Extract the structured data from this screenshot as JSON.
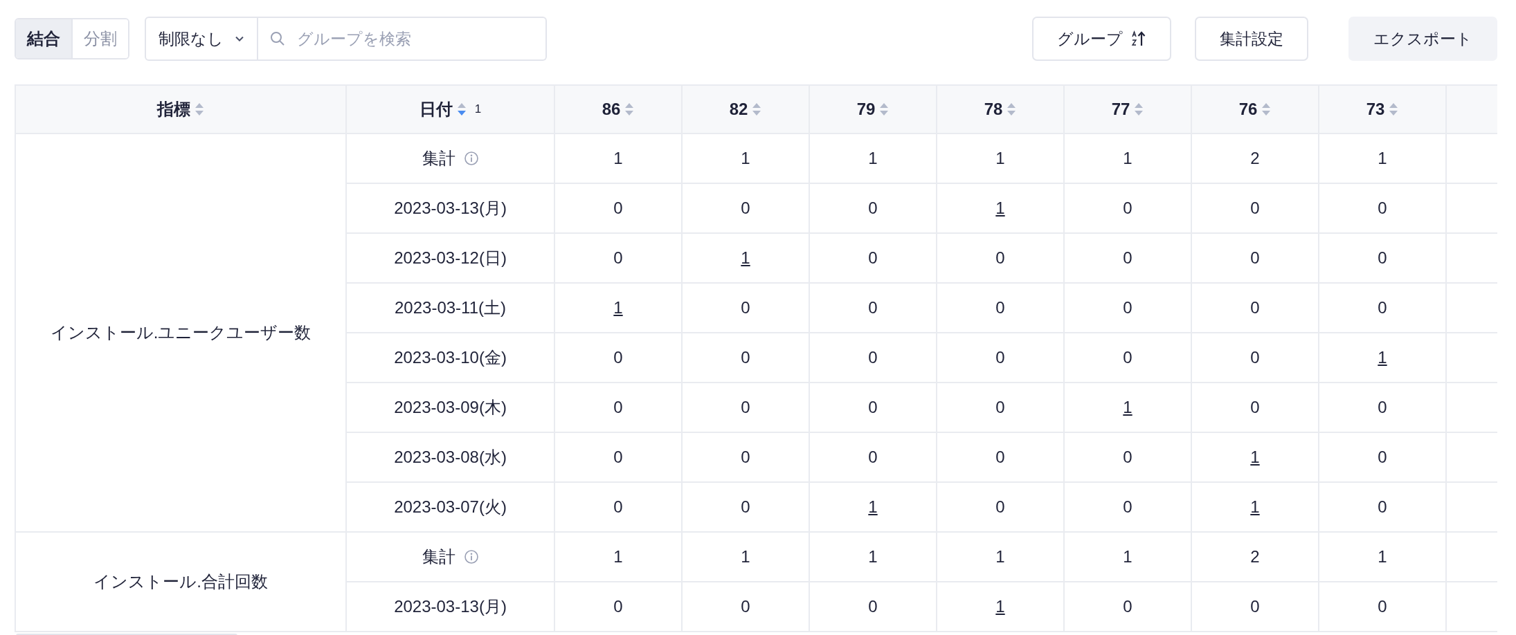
{
  "toolbar": {
    "view_toggle": [
      {
        "label": "結合",
        "selected": true
      },
      {
        "label": "分割",
        "selected": false
      }
    ],
    "limit_select": {
      "value": "制限なし"
    },
    "search": {
      "placeholder": "グループを検索"
    },
    "buttons": [
      {
        "label": "グループ",
        "kind": "sort"
      },
      {
        "label": "集計設定",
        "kind": "outline"
      },
      {
        "label": "エクスポート",
        "kind": "filled"
      }
    ]
  },
  "table": {
    "columns": [
      {
        "label": "指標",
        "sorted": false
      },
      {
        "label": "日付",
        "sorted": true,
        "priority": "1"
      },
      {
        "label": "86",
        "sorted": false
      },
      {
        "label": "82",
        "sorted": false
      },
      {
        "label": "79",
        "sorted": false
      },
      {
        "label": "78",
        "sorted": false
      },
      {
        "label": "77",
        "sorted": false
      },
      {
        "label": "76",
        "sorted": false
      },
      {
        "label": "73",
        "sorted": false
      }
    ],
    "groups": [
      {
        "metric": "インストール.ユニークユーザー数",
        "rows": [
          {
            "label": "集計",
            "kind": "total",
            "cells": [
              {
                "text": "1",
                "linked": false
              },
              {
                "text": "1",
                "linked": false
              },
              {
                "text": "1",
                "linked": false
              },
              {
                "text": "1",
                "linked": false
              },
              {
                "text": "1",
                "linked": false
              },
              {
                "text": "2",
                "linked": false
              },
              {
                "text": "1",
                "linked": false
              }
            ]
          },
          {
            "label": "2023-03-13(月)",
            "kind": "date",
            "cells": [
              {
                "text": "0",
                "linked": false
              },
              {
                "text": "0",
                "linked": false
              },
              {
                "text": "0",
                "linked": false
              },
              {
                "text": "1",
                "linked": true
              },
              {
                "text": "0",
                "linked": false
              },
              {
                "text": "0",
                "linked": false
              },
              {
                "text": "0",
                "linked": false
              }
            ]
          },
          {
            "label": "2023-03-12(日)",
            "kind": "date",
            "cells": [
              {
                "text": "0",
                "linked": false
              },
              {
                "text": "1",
                "linked": true
              },
              {
                "text": "0",
                "linked": false
              },
              {
                "text": "0",
                "linked": false
              },
              {
                "text": "0",
                "linked": false
              },
              {
                "text": "0",
                "linked": false
              },
              {
                "text": "0",
                "linked": false
              }
            ]
          },
          {
            "label": "2023-03-11(土)",
            "kind": "date",
            "cells": [
              {
                "text": "1",
                "linked": true
              },
              {
                "text": "0",
                "linked": false
              },
              {
                "text": "0",
                "linked": false
              },
              {
                "text": "0",
                "linked": false
              },
              {
                "text": "0",
                "linked": false
              },
              {
                "text": "0",
                "linked": false
              },
              {
                "text": "0",
                "linked": false
              }
            ]
          },
          {
            "label": "2023-03-10(金)",
            "kind": "date",
            "cells": [
              {
                "text": "0",
                "linked": false
              },
              {
                "text": "0",
                "linked": false
              },
              {
                "text": "0",
                "linked": false
              },
              {
                "text": "0",
                "linked": false
              },
              {
                "text": "0",
                "linked": false
              },
              {
                "text": "0",
                "linked": false
              },
              {
                "text": "1",
                "linked": true
              }
            ]
          },
          {
            "label": "2023-03-09(木)",
            "kind": "date",
            "cells": [
              {
                "text": "0",
                "linked": false
              },
              {
                "text": "0",
                "linked": false
              },
              {
                "text": "0",
                "linked": false
              },
              {
                "text": "0",
                "linked": false
              },
              {
                "text": "1",
                "linked": true
              },
              {
                "text": "0",
                "linked": false
              },
              {
                "text": "0",
                "linked": false
              }
            ]
          },
          {
            "label": "2023-03-08(水)",
            "kind": "date",
            "cells": [
              {
                "text": "0",
                "linked": false
              },
              {
                "text": "0",
                "linked": false
              },
              {
                "text": "0",
                "linked": false
              },
              {
                "text": "0",
                "linked": false
              },
              {
                "text": "0",
                "linked": false
              },
              {
                "text": "1",
                "linked": true
              },
              {
                "text": "0",
                "linked": false
              }
            ]
          },
          {
            "label": "2023-03-07(火)",
            "kind": "date",
            "cells": [
              {
                "text": "0",
                "linked": false
              },
              {
                "text": "0",
                "linked": false
              },
              {
                "text": "1",
                "linked": true
              },
              {
                "text": "0",
                "linked": false
              },
              {
                "text": "0",
                "linked": false
              },
              {
                "text": "1",
                "linked": true
              },
              {
                "text": "0",
                "linked": false
              }
            ]
          }
        ]
      },
      {
        "metric": "インストール.合計回数",
        "rows": [
          {
            "label": "集計",
            "kind": "total",
            "cells": [
              {
                "text": "1",
                "linked": false
              },
              {
                "text": "1",
                "linked": false
              },
              {
                "text": "1",
                "linked": false
              },
              {
                "text": "1",
                "linked": false
              },
              {
                "text": "1",
                "linked": false
              },
              {
                "text": "2",
                "linked": false
              },
              {
                "text": "1",
                "linked": false
              }
            ]
          },
          {
            "label": "2023-03-13(月)",
            "kind": "date",
            "cells": [
              {
                "text": "0",
                "linked": false
              },
              {
                "text": "0",
                "linked": false
              },
              {
                "text": "0",
                "linked": false
              },
              {
                "text": "1",
                "linked": true
              },
              {
                "text": "0",
                "linked": false
              },
              {
                "text": "0",
                "linked": false
              },
              {
                "text": "0",
                "linked": false
              }
            ]
          }
        ]
      }
    ]
  }
}
